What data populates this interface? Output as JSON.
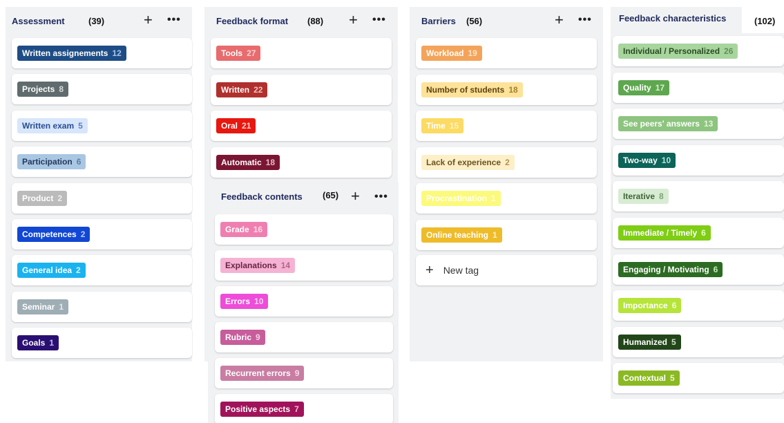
{
  "columns": {
    "assessment": {
      "title": "Assessment",
      "count": "(39)",
      "cards": [
        {
          "label": "Written assignements",
          "num": "12",
          "bg": "#1e4d86",
          "fg": "#ffffff",
          "nc": "#a8c3ea"
        },
        {
          "label": "Projects",
          "num": "8",
          "bg": "#5f6b6d",
          "fg": "#ffffff",
          "nc": "#d5dadb"
        },
        {
          "label": "Written exam",
          "num": "5",
          "bg": "#d8e6fb",
          "fg": "#2a4d8f",
          "nc": "#5a7ec0"
        },
        {
          "label": "Participation",
          "num": "6",
          "bg": "#a9c6e3",
          "fg": "#233a5e",
          "nc": "#5b7ea6"
        },
        {
          "label": "Product",
          "num": "2",
          "bg": "#bbbbbb",
          "fg": "#ffffff",
          "nc": "#eeeeee"
        },
        {
          "label": "Competences",
          "num": "2",
          "bg": "#1147d3",
          "fg": "#ffffff",
          "nc": "#b9cbff"
        },
        {
          "label": "General idea",
          "num": "2",
          "bg": "#1ab3ef",
          "fg": "#ffffff",
          "nc": "#d4f1ff"
        },
        {
          "label": "Seminar",
          "num": "1",
          "bg": "#9fadb4",
          "fg": "#ffffff",
          "nc": "#e2e8eb"
        },
        {
          "label": "Goals",
          "num": "1",
          "bg": "#2a0f72",
          "fg": "#ffffff",
          "nc": "#c6b8f0"
        }
      ]
    },
    "format": {
      "title": "Feedback format",
      "count": "(88)",
      "cards": [
        {
          "label": "Tools",
          "num": "27",
          "bg": "#e86b6d",
          "fg": "#ffffff",
          "nc": "#ffd0d0"
        },
        {
          "label": "Written",
          "num": "22",
          "bg": "#b0302d",
          "fg": "#ffffff",
          "nc": "#f2c0be"
        },
        {
          "label": "Oral",
          "num": "21",
          "bg": "#e8170f",
          "fg": "#ffffff",
          "nc": "#ffd0cc"
        },
        {
          "label": "Automatic",
          "num": "18",
          "bg": "#7a1633",
          "fg": "#ffffff",
          "nc": "#e7b9c6"
        }
      ]
    },
    "contents": {
      "title": "Feedback contents",
      "count": "(65)",
      "cards": [
        {
          "label": "Grade",
          "num": "16",
          "bg": "#ef7fb0",
          "fg": "#ffffff",
          "nc": "#ffd8e8"
        },
        {
          "label": "Explanations",
          "num": "14",
          "bg": "#f5b3d3",
          "fg": "#6b2347",
          "nc": "#b5648b"
        },
        {
          "label": "Errors",
          "num": "10",
          "bg": "#ee4cd9",
          "fg": "#ffffff",
          "nc": "#ffd0f7"
        },
        {
          "label": "Rubric",
          "num": "9",
          "bg": "#c75d9a",
          "fg": "#ffffff",
          "nc": "#f7d0e6"
        },
        {
          "label": "Recurrent errors",
          "num": "9",
          "bg": "#c97da2",
          "fg": "#ffffff",
          "nc": "#f5dbe8"
        },
        {
          "label": "Positive aspects",
          "num": "7",
          "bg": "#a0135a",
          "fg": "#ffffff",
          "nc": "#f2b7d4"
        }
      ]
    },
    "barriers": {
      "title": "Barriers",
      "count": "(56)",
      "cards": [
        {
          "label": "Workload",
          "num": "19",
          "bg": "#f4a45a",
          "fg": "#ffffff",
          "nc": "#ffe2c5"
        },
        {
          "label": "Number of students",
          "num": "18",
          "bg": "#fde29a",
          "fg": "#5c4410",
          "nc": "#a2822f"
        },
        {
          "label": "Time",
          "num": "15",
          "bg": "#fbdb63",
          "fg": "#ffffff",
          "nc": "#fff3c3"
        },
        {
          "label": "Lack of experience",
          "num": "2",
          "bg": "#fdefc8",
          "fg": "#6b5420",
          "nc": "#b09550"
        },
        {
          "label": "Procrastination",
          "num": "1",
          "bg": "#fcfa7c",
          "fg": "#ffffff",
          "nc": "#ffffd8"
        },
        {
          "label": "Online teaching",
          "num": "1",
          "bg": "#eebb2a",
          "fg": "#ffffff",
          "nc": "#fff0c2"
        }
      ],
      "new_tag_label": "New tag"
    },
    "characteristics": {
      "title": "Feedback characteristics",
      "count": "(102)",
      "cards": [
        {
          "label": "Individual / Personalized",
          "num": "26",
          "bg": "#a8d59e",
          "fg": "#294d22",
          "nc": "#5d9354"
        },
        {
          "label": "Quality",
          "num": "17",
          "bg": "#5ea74f",
          "fg": "#ffffff",
          "nc": "#d7f0d0"
        },
        {
          "label": "See peers' answers",
          "num": "13",
          "bg": "#8dc47f",
          "fg": "#ffffff",
          "nc": "#e2f5dc"
        },
        {
          "label": "Two-way",
          "num": "10",
          "bg": "#0d6458",
          "fg": "#ffffff",
          "nc": "#b4e4dc"
        },
        {
          "label": "Iterative",
          "num": "8",
          "bg": "#d8ecd3",
          "fg": "#3f6638",
          "nc": "#7ea375"
        },
        {
          "label": "Immediate / Timely",
          "num": "6",
          "bg": "#7fcd15",
          "fg": "#ffffff",
          "nc": "#e4ffbe"
        },
        {
          "label": "Engaging / Motivating",
          "num": "6",
          "bg": "#2d6b24",
          "fg": "#ffffff",
          "nc": "#c6ecbe"
        },
        {
          "label": "Importance",
          "num": "6",
          "bg": "#b6e43a",
          "fg": "#ffffff",
          "nc": "#f0ffd0"
        },
        {
          "label": "Humanized",
          "num": "5",
          "bg": "#22461a",
          "fg": "#ffffff",
          "nc": "#c7e0bf"
        },
        {
          "label": "Contextual",
          "num": "5",
          "bg": "#8bb923",
          "fg": "#ffffff",
          "nc": "#eaf7c8"
        }
      ]
    }
  }
}
